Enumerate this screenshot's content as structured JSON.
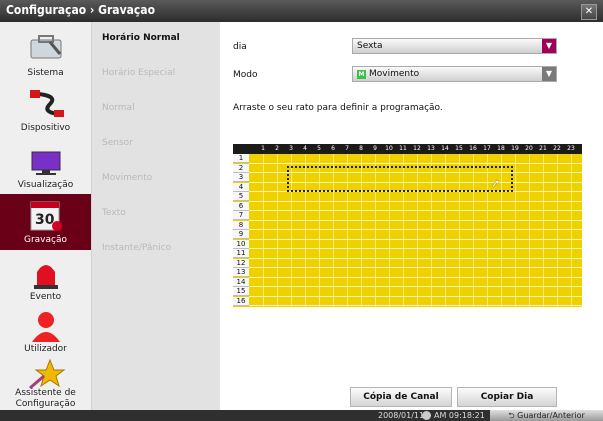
{
  "window": {
    "title": "Configuraçao › Gravaçao",
    "close_glyph": "✕"
  },
  "sidebar": {
    "items": [
      {
        "label": "Sistema",
        "icon": "toolbox-icon"
      },
      {
        "label": "Dispositivo",
        "icon": "cable-icon"
      },
      {
        "label": "Visualização",
        "icon": "monitor-icon"
      },
      {
        "label": "Gravação",
        "icon": "calendar-icon",
        "calendar_text": "30",
        "active": true
      },
      {
        "label": "Evento",
        "icon": "siren-icon"
      },
      {
        "label": "Utilizador",
        "icon": "user-icon"
      },
      {
        "label": "Assistente de Configuração",
        "icon": "wizard-star-icon"
      }
    ]
  },
  "submenu": {
    "items": [
      {
        "label": "Horário Normal",
        "active": true
      },
      {
        "label": "Horário Especial"
      },
      {
        "label": "Normal"
      },
      {
        "label": "Sensor"
      },
      {
        "label": "Movimento"
      },
      {
        "label": "Texto"
      },
      {
        "label": "Instante/Pânico"
      }
    ]
  },
  "form": {
    "dia_label": "dia",
    "dia_value": "Sexta",
    "modo_label": "Modo",
    "modo_value": "Movimento",
    "modo_swatch_letter": "M",
    "instruction": "Arraste o seu rato para definir a programação."
  },
  "schedule": {
    "hours": [
      "1",
      "2",
      "3",
      "4",
      "5",
      "6",
      "7",
      "8",
      "9",
      "10",
      "11",
      "12",
      "13",
      "14",
      "15",
      "16",
      "17",
      "18",
      "19",
      "20",
      "21",
      "22",
      "23"
    ],
    "rows": [
      "1",
      "2",
      "3",
      "4",
      "5",
      "6",
      "7",
      "8",
      "9",
      "10",
      "11",
      "12",
      "13",
      "14",
      "15",
      "16"
    ],
    "fill_color": "#efd100",
    "selection": {
      "hour_start": 3,
      "hour_end": 18,
      "row_start": 2,
      "row_end": 4
    }
  },
  "buttons": {
    "copy_channel": "Cópia de Canal",
    "copy_day": "Copiar Dia"
  },
  "footer": {
    "datetime": "2008/01/11",
    "time": "AM 09:18:21",
    "save_back": "Guardar/Anterior"
  },
  "colors": {
    "active_nav": "#6a0017",
    "dropdown_arrow": "#a0005a",
    "modo_swatch": "#3cc24a"
  }
}
